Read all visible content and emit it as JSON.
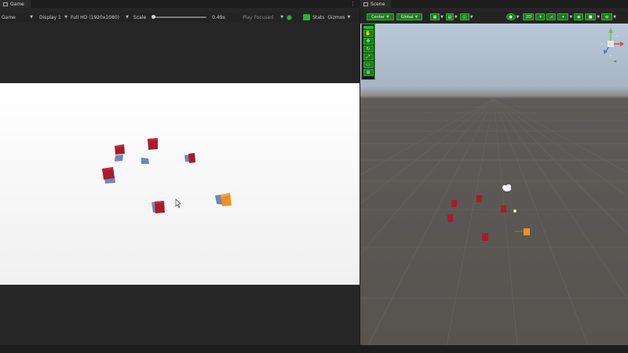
{
  "game_panel": {
    "tab_label": "Game",
    "toolbar": {
      "view_mode": "Game",
      "display": "Display 1",
      "resolution": "Full HD (1920x1080)",
      "scale_label": "Scale",
      "scale_value": "0.49x",
      "play_mode": "Play Focused",
      "stats_label": "Stats",
      "gizmos_label": "Gizmos"
    }
  },
  "scene_panel": {
    "tab_label": "Scene",
    "toolbar": {
      "pivot_label": "Center",
      "space_label": "Global",
      "mode_2d": "2D"
    }
  },
  "colors": {
    "cube_red": "#a61c2c",
    "cube_blue": "#6f86b5",
    "cube_orange": "#ee8f25",
    "accent_green": "#2bb52b"
  }
}
